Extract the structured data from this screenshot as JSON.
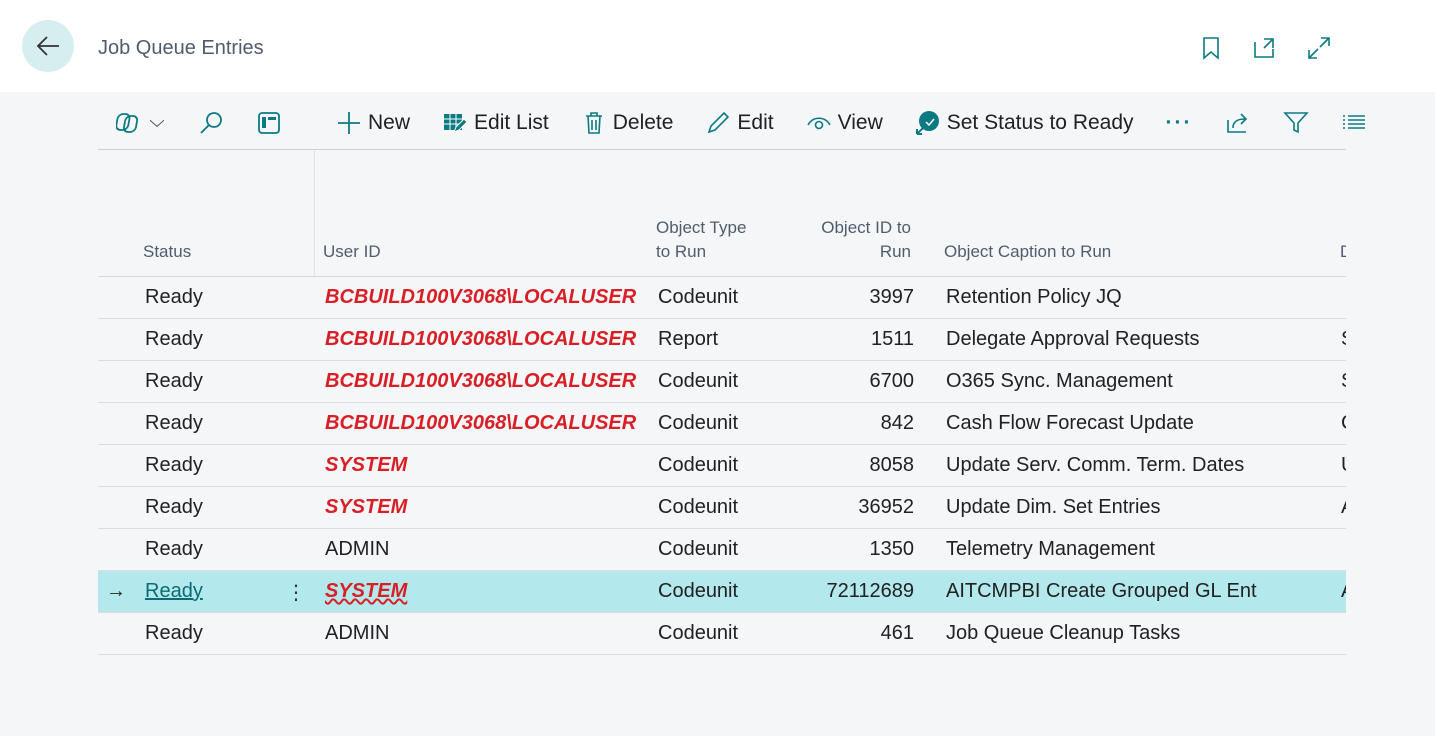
{
  "header": {
    "title": "Job Queue Entries"
  },
  "toolbar": {
    "new": "New",
    "edit_list": "Edit List",
    "delete": "Delete",
    "edit": "Edit",
    "view": "View",
    "set_status": "Set Status to Ready",
    "more": "···"
  },
  "columns": {
    "status": "Status",
    "user_id": "User ID",
    "object_type": "Object Type\nto Run",
    "object_id": "Object ID to\nRun",
    "caption": "Object Caption to Run",
    "next": "D"
  },
  "rows": [
    {
      "status": "Ready",
      "user": "BCBUILD100V3068\\LOCALUSER",
      "user_error": true,
      "type": "Codeunit",
      "id": "3997",
      "caption": "Retention Policy JQ",
      "next": ""
    },
    {
      "status": "Ready",
      "user": "BCBUILD100V3068\\LOCALUSER",
      "user_error": true,
      "type": "Report",
      "id": "1511",
      "caption": "Delegate Approval Requests",
      "next": "S"
    },
    {
      "status": "Ready",
      "user": "BCBUILD100V3068\\LOCALUSER",
      "user_error": true,
      "type": "Codeunit",
      "id": "6700",
      "caption": "O365 Sync. Management",
      "next": "S"
    },
    {
      "status": "Ready",
      "user": "BCBUILD100V3068\\LOCALUSER",
      "user_error": true,
      "type": "Codeunit",
      "id": "842",
      "caption": "Cash Flow Forecast Update",
      "next": "C"
    },
    {
      "status": "Ready",
      "user": "SYSTEM",
      "user_error": true,
      "type": "Codeunit",
      "id": "8058",
      "caption": "Update Serv. Comm. Term. Dates",
      "next": "U"
    },
    {
      "status": "Ready",
      "user": "SYSTEM",
      "user_error": true,
      "type": "Codeunit",
      "id": "36952",
      "caption": "Update Dim. Set Entries",
      "next": "A"
    },
    {
      "status": "Ready",
      "user": "ADMIN",
      "user_error": false,
      "type": "Codeunit",
      "id": "1350",
      "caption": "Telemetry Management",
      "next": ""
    },
    {
      "status": "Ready",
      "user": "SYSTEM",
      "user_error": true,
      "type": "Codeunit",
      "id": "72112689",
      "caption": "AITCMPBI Create Grouped GL Ent",
      "next": "A",
      "selected": true
    },
    {
      "status": "Ready",
      "user": "ADMIN",
      "user_error": false,
      "type": "Codeunit",
      "id": "461",
      "caption": "Job Queue Cleanup Tasks",
      "next": ""
    }
  ],
  "colors": {
    "accent": "#0b7a82",
    "selected_row": "#b3e8ec",
    "error_text": "#d91f26"
  }
}
